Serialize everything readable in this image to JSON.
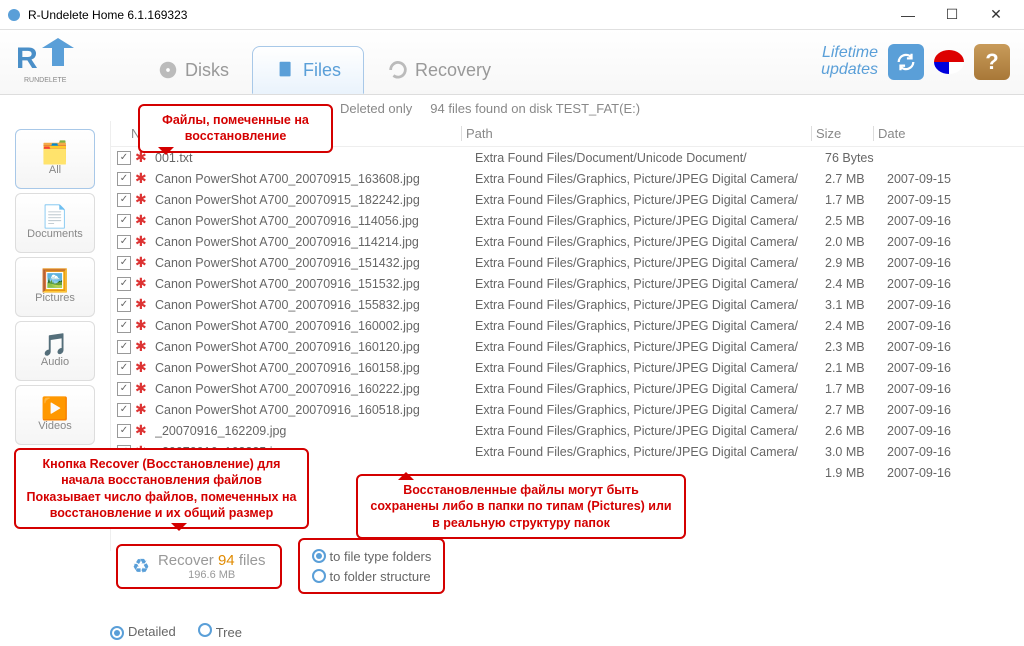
{
  "window": {
    "title": "R-Undelete Home 6.1.169323"
  },
  "tabs": {
    "disks": "Disks",
    "files": "Files",
    "recovery": "Recovery"
  },
  "header": {
    "lifetime1": "Lifetime",
    "lifetime2": "updates"
  },
  "filter": {
    "deleted": "Deleted only",
    "status": "94 files found on disk TEST_FAT(E:)"
  },
  "sidebar": {
    "all": "All",
    "documents": "Documents",
    "pictures": "Pictures",
    "audio": "Audio",
    "videos": "Videos"
  },
  "columns": {
    "name": "Name ▲",
    "path": "Path",
    "size": "Size",
    "date": "Date"
  },
  "files": [
    {
      "name": "001.txt",
      "path": "Extra Found Files/Document/Unicode Document/",
      "size": "76 Bytes",
      "date": ""
    },
    {
      "name": "Canon PowerShot A700_20070915_163608.jpg",
      "path": "Extra Found Files/Graphics, Picture/JPEG Digital Camera/",
      "size": "2.7 MB",
      "date": "2007-09-15"
    },
    {
      "name": "Canon PowerShot A700_20070915_182242.jpg",
      "path": "Extra Found Files/Graphics, Picture/JPEG Digital Camera/",
      "size": "1.7 MB",
      "date": "2007-09-15"
    },
    {
      "name": "Canon PowerShot A700_20070916_114056.jpg",
      "path": "Extra Found Files/Graphics, Picture/JPEG Digital Camera/",
      "size": "2.5 MB",
      "date": "2007-09-16"
    },
    {
      "name": "Canon PowerShot A700_20070916_114214.jpg",
      "path": "Extra Found Files/Graphics, Picture/JPEG Digital Camera/",
      "size": "2.0 MB",
      "date": "2007-09-16"
    },
    {
      "name": "Canon PowerShot A700_20070916_151432.jpg",
      "path": "Extra Found Files/Graphics, Picture/JPEG Digital Camera/",
      "size": "2.9 MB",
      "date": "2007-09-16"
    },
    {
      "name": "Canon PowerShot A700_20070916_151532.jpg",
      "path": "Extra Found Files/Graphics, Picture/JPEG Digital Camera/",
      "size": "2.4 MB",
      "date": "2007-09-16"
    },
    {
      "name": "Canon PowerShot A700_20070916_155832.jpg",
      "path": "Extra Found Files/Graphics, Picture/JPEG Digital Camera/",
      "size": "3.1 MB",
      "date": "2007-09-16"
    },
    {
      "name": "Canon PowerShot A700_20070916_160002.jpg",
      "path": "Extra Found Files/Graphics, Picture/JPEG Digital Camera/",
      "size": "2.4 MB",
      "date": "2007-09-16"
    },
    {
      "name": "Canon PowerShot A700_20070916_160120.jpg",
      "path": "Extra Found Files/Graphics, Picture/JPEG Digital Camera/",
      "size": "2.3 MB",
      "date": "2007-09-16"
    },
    {
      "name": "Canon PowerShot A700_20070916_160158.jpg",
      "path": "Extra Found Files/Graphics, Picture/JPEG Digital Camera/",
      "size": "2.1 MB",
      "date": "2007-09-16"
    },
    {
      "name": "Canon PowerShot A700_20070916_160222.jpg",
      "path": "Extra Found Files/Graphics, Picture/JPEG Digital Camera/",
      "size": "1.7 MB",
      "date": "2007-09-16"
    },
    {
      "name": "Canon PowerShot A700_20070916_160518.jpg",
      "path": "Extra Found Files/Graphics, Picture/JPEG Digital Camera/",
      "size": "2.7 MB",
      "date": "2007-09-16"
    },
    {
      "name": "_20070916_162209.jpg",
      "path": "Extra Found Files/Graphics, Picture/JPEG Digital Camera/",
      "size": "2.6 MB",
      "date": "2007-09-16"
    },
    {
      "name": "_20070916_162235.jpg",
      "path": "Extra Found Files/Graphics, Picture/JPEG Digital Camera/",
      "size": "3.0 MB",
      "date": "2007-09-16"
    },
    {
      "name": "",
      "path": "",
      "size": "1.9 MB",
      "date": "2007-09-16"
    }
  ],
  "view": {
    "detailed": "Detailed",
    "tree": "Tree"
  },
  "recover": {
    "label1": "Recover ",
    "count": "94",
    "label2": " files",
    "size": "196.6 MB"
  },
  "saveopts": {
    "type": "to file type folders",
    "struct": "to folder structure"
  },
  "callouts": {
    "marked": "Файлы, помеченные на восстановление",
    "button": "Кнопка Recover (Восстановление) для начала восстановления файлов Показывает число файлов, помеченных на восстановление и их общий размер",
    "saved": "Восстановленные файлы могут быть сохранены либо в папки по типам (Pictures) или в реальную структуру папок"
  }
}
